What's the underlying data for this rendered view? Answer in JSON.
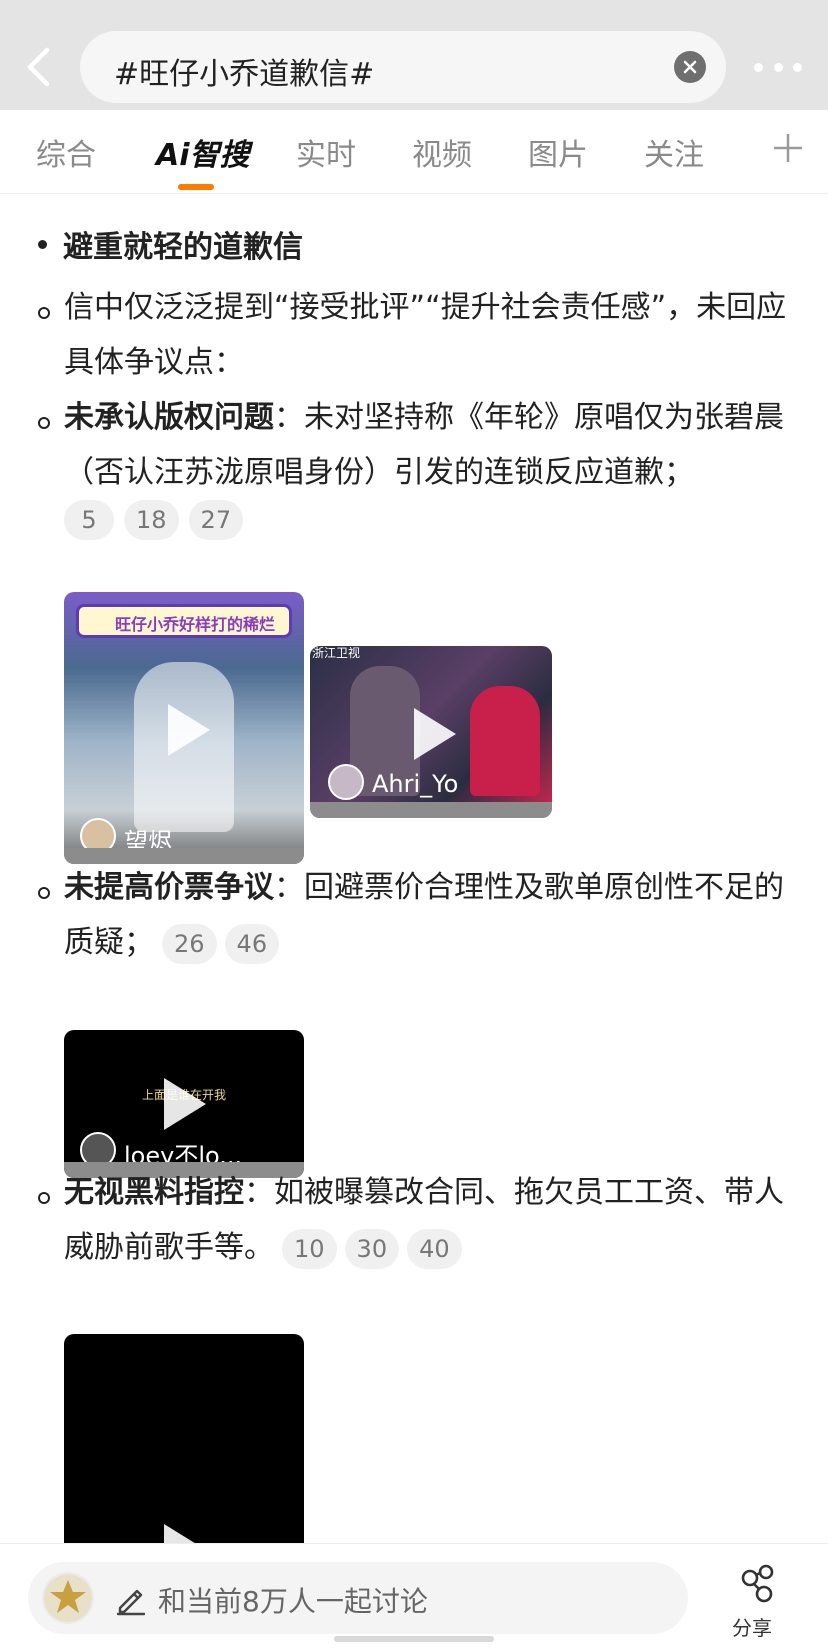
{
  "search": {
    "query": "#旺仔小乔道歉信#"
  },
  "tabs": [
    {
      "label": "综合"
    },
    {
      "label": "Ai智搜"
    },
    {
      "label": "实时"
    },
    {
      "label": "视频"
    },
    {
      "label": "图片"
    },
    {
      "label": "关注"
    }
  ],
  "content": {
    "heading": "避重就轻的道歉信",
    "p1": "信中仅泛泛提到“接受批评”“提升社会责任感”，未回应具体争议点：",
    "p2_bold": "未承认版权问题",
    "p2_text": "：未对坚持称《年轮》原唱仅为张碧晨（否认汪苏泷原唱身份）引发的连锁反应道歉；",
    "p2_refs": [
      "5",
      "18",
      "27"
    ],
    "video1_label": "旺仔小乔好样打的稀烂",
    "video1_user": "望烬",
    "video2_channel": "浙江卫视",
    "video2_user": "Ahri_Yo",
    "p3_bold": "未提高价票争议",
    "p3_text": "：回避票价合理性及歌单原创性不足的质疑；",
    "p3_refs": [
      "26",
      "46"
    ],
    "video3_caption": "上面是谁在开我",
    "video3_user": "loey不lo...",
    "p4_bold": "无视黑料指控",
    "p4_text": "：如被曝篡改合同、拖欠员工工资、带人威胁前歌手等。",
    "p4_refs": [
      "10",
      "30",
      "40"
    ]
  },
  "bottom": {
    "discuss_placeholder": "和当前8万人一起讨论",
    "share_label": "分享"
  },
  "colors": {
    "accent": "#ff7a00",
    "topbar": "#e4e4e4"
  }
}
